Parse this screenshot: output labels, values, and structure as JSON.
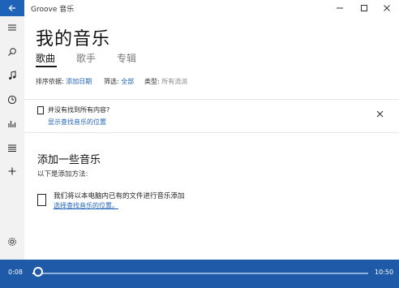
{
  "window": {
    "app_title": "Groove 音乐"
  },
  "page": {
    "title": "我的音乐",
    "tabs": [
      {
        "label": "歌曲",
        "selected": true
      },
      {
        "label": "歌手",
        "selected": false
      },
      {
        "label": "专辑",
        "selected": false
      }
    ]
  },
  "filters": {
    "sort_label": "排序依据:",
    "sort_value": "添加日期",
    "filter_label": "筛选:",
    "filter_value": "全部",
    "type_label": "类型:",
    "type_value": "所有流派"
  },
  "notice": {
    "text": "并没有找到所有内容?",
    "link": "显示查找音乐的位置"
  },
  "add_music": {
    "title": "添加一些音乐",
    "subtitle": "以下是添加方法:",
    "item_text": "我们将以本电脑内已有的文件进行音乐添加",
    "item_link": "选择查找音乐的位置。"
  },
  "player": {
    "elapsed": "0:08",
    "duration": "10:50",
    "progress": 0.012
  },
  "colors": {
    "accent": "#1e63b8",
    "player_bg": "#1e5aa8"
  }
}
